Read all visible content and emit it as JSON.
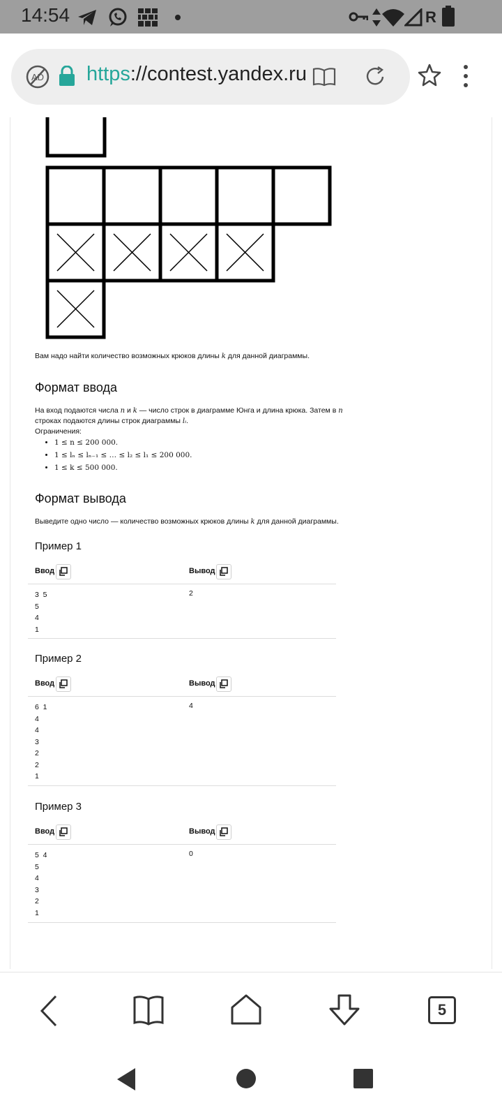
{
  "status_bar": {
    "time": "14:54",
    "icons": [
      "telegram-icon",
      "whatsapp-icon",
      "firewall-icon",
      "dot-icon",
      "vpn-key-icon",
      "data-arrows-icon",
      "wifi-icon",
      "signal-icon",
      "roaming-r-icon",
      "battery-icon"
    ],
    "roaming_label": "R"
  },
  "browser": {
    "url_scheme": "https",
    "url_rest": "://contest.yandex.ru",
    "icons": [
      "adblock-icon",
      "lock-icon",
      "reader-mode-icon",
      "reload-icon",
      "bookmark-star-icon",
      "more-menu-icon"
    ]
  },
  "problem": {
    "task_text_1": "Вам надо найти количество возможных крюков длины ",
    "task_var_k": "k",
    "task_text_2": " для данной диаграммы.",
    "input_heading": "Формат ввода",
    "input_line1_a": "На вход подаются числа ",
    "input_var_n": "n",
    "input_line1_b": " и ",
    "input_var_k": "k",
    "input_line1_c": " — число строк в диаграмме Юнга и длина крюка. Затем в ",
    "input_var_n2": "n",
    "input_line2_a": "строках подаются длины строк диаграммы ",
    "input_var_li": "lᵢ",
    "input_line2_b": ".",
    "constraints_label": "Ограничения:",
    "constraints": [
      "1 ≤ n ≤ 200 000.",
      "1 ≤ lₙ ≤ lₙ₋₁ ≤ … ≤ l₂ ≤ l₁ ≤ 200 000.",
      "1 ≤ k ≤ 500 000."
    ],
    "output_heading": "Формат вывода",
    "output_text_1": "Выведите одно число — количество возможных крюков длины ",
    "output_var_k": "k",
    "output_text_2": " для данной диаграммы."
  },
  "examples": [
    {
      "title": "Пример 1",
      "input_label": "Ввод",
      "output_label": "Вывод",
      "input": "3  5\n5\n4\n1",
      "output": "2"
    },
    {
      "title": "Пример 2",
      "input_label": "Ввод",
      "output_label": "Вывод",
      "input": "6  1\n4\n4\n3\n2\n2\n1",
      "output": "4"
    },
    {
      "title": "Пример 3",
      "input_label": "Ввод",
      "output_label": "Вывод",
      "input": "5  4\n5\n4\n3\n2\n1",
      "output": "0"
    }
  ],
  "diagram": {
    "rows": [
      5,
      4,
      1
    ],
    "crossed_rows": [
      2,
      3
    ]
  },
  "bottom_nav": {
    "tabs_count": "5",
    "icons": [
      "back-icon",
      "bookmarks-icon",
      "home-icon",
      "downloads-icon",
      "tabs-icon"
    ]
  },
  "system_nav": {
    "icons": [
      "system-back-icon",
      "system-home-icon",
      "system-recents-icon"
    ]
  }
}
